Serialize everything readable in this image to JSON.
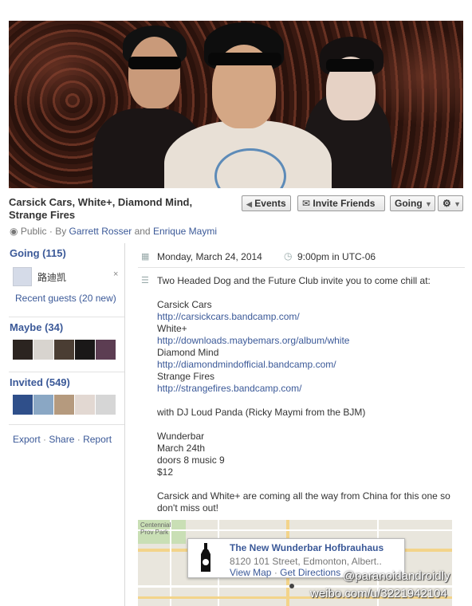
{
  "event": {
    "title_line1": "Carsick Cars, White+, Diamond Mind,",
    "title_line2": "Strange Fires",
    "privacy": "Public",
    "by_prefix": "By",
    "host1": "Garrett Rosser",
    "and": "and",
    "host2": "Enrique Maymi"
  },
  "buttons": {
    "events": "Events",
    "invite": "Invite Friends",
    "going": "Going"
  },
  "sidebar": {
    "going": "Going (115)",
    "guest_name": "路迪凯",
    "recent": "Recent guests (20 new)",
    "maybe": "Maybe (34)",
    "invited": "Invited (549)",
    "export": "Export",
    "share": "Share",
    "report": "Report"
  },
  "details": {
    "date": "Monday, March 24, 2014",
    "time": "9:00pm in UTC-06",
    "desc": {
      "intro": "Two Headed Dog and the Future Club invite you to come chill at:",
      "band1": "Carsick Cars",
      "link1": "http://carsickcars.bandcamp.com/",
      "band2": "White+",
      "link2": "http://downloads.maybemars.org/album/white",
      "band3": "Diamond Mind",
      "link3": "http://diamondmindofficial.bandcamp.com/",
      "band4": "Strange Fires",
      "link4": "http://strangefires.bandcamp.com/",
      "dj": "with DJ Loud Panda (Ricky Maymi from the BJM)",
      "venue": "Wunderbar",
      "date": "March 24th",
      "doors": "doors 8 music 9",
      "price": "$12",
      "outro": "Carsick and White+ are coming all the way from China for this one so don't miss out!"
    }
  },
  "map": {
    "park": "Centennial Prov Park",
    "venue_name": "The New Wunderbar Hofbrauhaus",
    "address": "8120 101 Street, Edmonton, Albert..",
    "view_map": "View Map",
    "directions": "Get Directions"
  },
  "watermark": {
    "handle": "@paranoidandroidly",
    "url": "weibo.com/u/3221942104"
  },
  "colors": {
    "link": "#3b5998",
    "text": "#333333"
  }
}
